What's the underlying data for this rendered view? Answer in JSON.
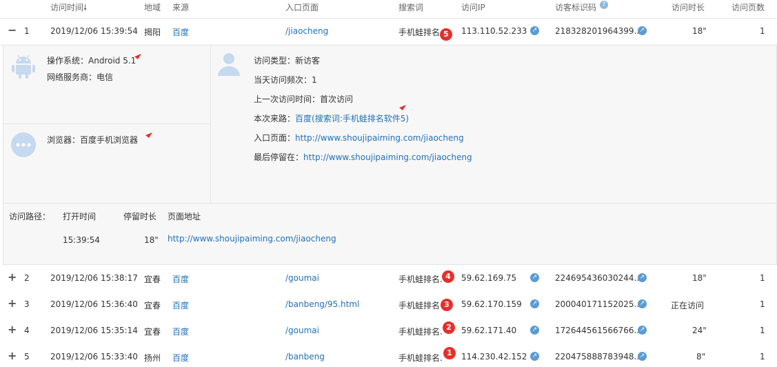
{
  "headers": {
    "visit_time": "访问时间",
    "region": "地域",
    "source": "来源",
    "entry_page": "入口页面",
    "search_term": "搜索词",
    "visit_ip": "访问IP",
    "visitor_id": "访客标识码",
    "duration": "访问时长",
    "pages": "访问页数"
  },
  "rows": [
    {
      "toggle": "−",
      "index": "1",
      "time": "2019/12/06 15:39:54",
      "region": "揭阳",
      "source": "百度",
      "entry": "/jiaocheng",
      "search": "手机蛙排名",
      "ip": "113.110.52.233",
      "visitor": "218328201964399...",
      "duration": "18\"",
      "pages": "1",
      "badge": "5"
    },
    {
      "toggle": "+",
      "index": "2",
      "time": "2019/12/06 15:38:17",
      "region": "宜春",
      "source": "百度",
      "entry": "/goumai",
      "search": "手机蛙排名.",
      "ip": "59.62.169.75",
      "visitor": "224695436030244...",
      "duration": "18\"",
      "pages": "1",
      "badge": "4"
    },
    {
      "toggle": "+",
      "index": "3",
      "time": "2019/12/06 15:36:40",
      "region": "宜春",
      "source": "百度",
      "entry": "/banbeng/95.html",
      "search": "手机蛙排名",
      "ip": "59.62.170.159",
      "visitor": "200040171152025...",
      "duration": "正在访问",
      "pages": "1",
      "badge": "3"
    },
    {
      "toggle": "+",
      "index": "4",
      "time": "2019/12/06 15:35:14",
      "region": "宜春",
      "source": "百度",
      "entry": "/goumai",
      "search": "手机蛙排名.",
      "ip": "59.62.171.40",
      "visitor": "172644561566766...",
      "duration": "24\"",
      "pages": "1",
      "badge": "2"
    },
    {
      "toggle": "+",
      "index": "5",
      "time": "2019/12/06 15:33:40",
      "region": "扬州",
      "source": "百度",
      "entry": "/banbeng",
      "search": "手机蛙排名.",
      "ip": "114.230.42.152",
      "visitor": "220475888783948...",
      "duration": "8\"",
      "pages": "1",
      "badge": "1"
    }
  ],
  "detail": {
    "os": "操作系统：Android 5.1",
    "isp": "网络服务商：电信",
    "browser": "浏览器：百度手机浏览器",
    "visit_type": "访问类型：新访客",
    "day_freq": "当天访问频次：1",
    "last_visit": "上一次访问时间：首次访问",
    "source_label": "本次来路：",
    "source_value": "百度(搜索词:手机蛙排名软件5)",
    "entry_label": "入口页面：",
    "entry_value": "http://www.shoujipaiming.com/jiaocheng",
    "last_stay_label": "最后停留在：",
    "last_stay_value": "http://www.shoujipaiming.com/jiaocheng",
    "path_label": "访问路径：",
    "path_open_time": "打开时间",
    "path_stay": "停留时长",
    "path_page": "页面地址",
    "path_time": "15:39:54",
    "path_duration": "18\"",
    "path_url": "http://www.shoujipaiming.com/jiaocheng"
  },
  "colors": {
    "link": "#1f70b8",
    "badge": "#e5302c",
    "icon": "#c5d9ef"
  }
}
